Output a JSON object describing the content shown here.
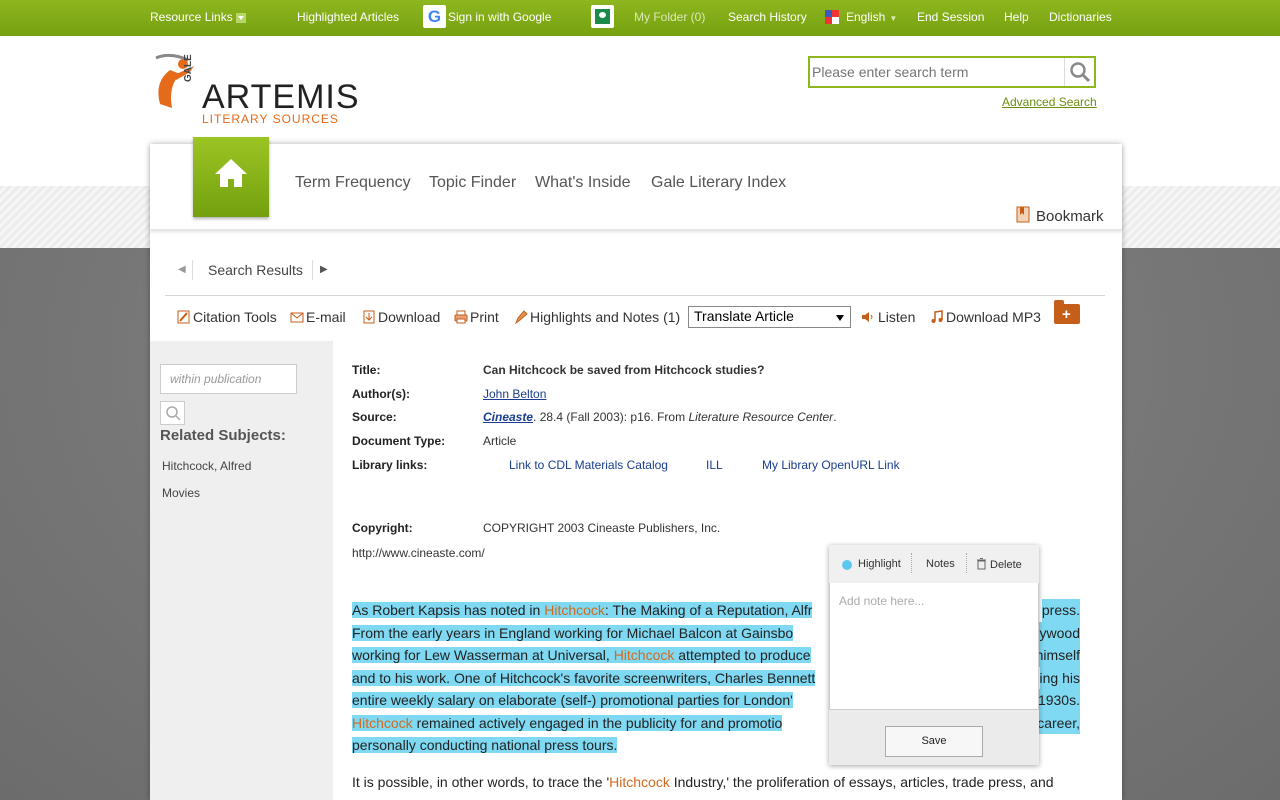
{
  "topbar": {
    "resource_links": "Resource Links",
    "highlighted_articles": "Highlighted Articles",
    "google_g": "G",
    "sign_in_google": "Sign in with Google",
    "my_folder": "My Folder (0)",
    "search_history": "Search History",
    "language": "English",
    "end_session": "End Session",
    "help": "Help",
    "dictionaries": "Dictionaries"
  },
  "logo": {
    "gale": "GALE",
    "title": "ARTEMIS",
    "subtitle": "LITERARY SOURCES"
  },
  "search": {
    "placeholder": "Please enter search term",
    "advanced": "Advanced Search"
  },
  "nav": {
    "items": [
      "Term Frequency",
      "Topic Finder",
      "What's Inside",
      "Gale Literary Index"
    ],
    "bookmark": "Bookmark"
  },
  "breadcrumb": {
    "label": "Search Results"
  },
  "toolbar": {
    "citation": "Citation Tools",
    "email": "E-mail",
    "download": "Download",
    "print": "Print",
    "highlights": "Highlights and Notes (1)",
    "translate": "Translate Article",
    "listen": "Listen",
    "download_mp3": "Download MP3"
  },
  "sidebar": {
    "within_placeholder": "within publication",
    "related_heading": "Related Subjects:",
    "subjects": [
      "Hitchcock, Alfred",
      "Movies"
    ]
  },
  "meta": {
    "title_label": "Title:",
    "title_value": "Can Hitchcock be saved from Hitchcock studies?",
    "author_label": "Author(s):",
    "author_value": "John Belton",
    "source_label": "Source:",
    "source_pub": "Cineaste",
    "source_rest": ". 28.4 (Fall 2003): p16. From ",
    "source_db": "Literature Resource Center",
    "source_end": ".",
    "doctype_label": "Document Type:",
    "doctype_value": "Article",
    "library_label": "Library links:",
    "library_links": [
      "Link to CDL Materials Catalog",
      "ILL",
      "My Library OpenURL Link"
    ],
    "copyright_label": "Copyright:",
    "copyright_value": "COPYRIGHT 2003 Cineaste Publishers, Inc.",
    "url": "http://www.cineaste.com/"
  },
  "article": {
    "p1_lines": [
      [
        "As Robert Kapsis has noted in ",
        "Hitchcock",
        ": The Making of a Reputation, Alfr"
      ],
      [
        "From the early years in England working for Michael Balcon at Gainsbo"
      ],
      [
        "working for Lew Wasserman at Universal, ",
        "Hitchcock",
        " attempted to produce"
      ],
      [
        "and to his work. One of Hitchcock's favorite screenwriters, Charles Bennett"
      ],
      [
        "entire weekly salary on elaborate (self-) promotional parties for London'"
      ],
      [
        "Hitchcock",
        " remained actively engaged in the publicity for and promotio"
      ],
      [
        "personally conducting national press tours."
      ]
    ],
    "p1_right": [
      "press.",
      "llywood",
      "himself",
      "ing his",
      "1930s.",
      "career,"
    ],
    "p2_a": "It is possible, in other words, to trace the '",
    "p2_kw": "Hitchcock",
    "p2_b": " Industry,' the proliferation of essays, articles, trade press, and"
  },
  "note": {
    "highlight": "Highlight",
    "notes": "Notes",
    "delete": "Delete",
    "placeholder": "Add note here...",
    "save": "Save"
  },
  "colors": {
    "brand_green": "#8db61f",
    "highlight_blue": "#7fd9f3",
    "keyword_orange": "#d2691e"
  }
}
